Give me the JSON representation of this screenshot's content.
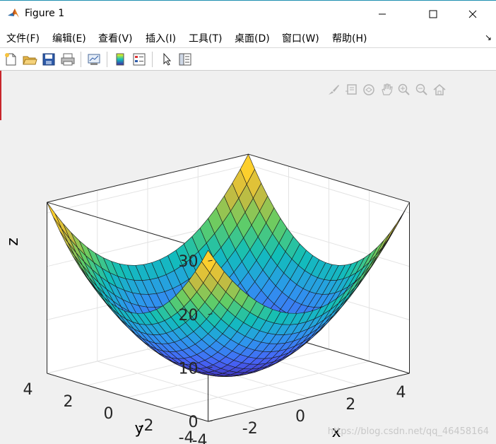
{
  "window": {
    "title": "Figure 1"
  },
  "menu": {
    "items": [
      "文件(F)",
      "编辑(E)",
      "查看(V)",
      "插入(I)",
      "工具(T)",
      "桌面(D)",
      "窗口(W)",
      "帮助(H)"
    ]
  },
  "axes": {
    "xlabel": "x",
    "ylabel": "y",
    "zlabel": "z",
    "x_ticks": [
      "-4",
      "-2",
      "0",
      "2",
      "4"
    ],
    "y_ticks": [
      "4",
      "2",
      "0",
      "-2",
      "-4"
    ],
    "z_ticks": [
      "0",
      "10",
      "20",
      "30"
    ]
  },
  "chart_data": {
    "type": "surface",
    "function": "z = x^2 + y^2",
    "x_range": [
      -4,
      4
    ],
    "y_range": [
      -4,
      4
    ],
    "zlim": [
      0,
      32
    ],
    "grid": "on",
    "colormap": "parula"
  },
  "watermark": "https://blog.csdn.net/qq_46458164",
  "colors": {
    "titlebar_accent": "#1f8fb0",
    "figure_bg": "#f0f0f0",
    "axes_bg": "#ffffff"
  }
}
